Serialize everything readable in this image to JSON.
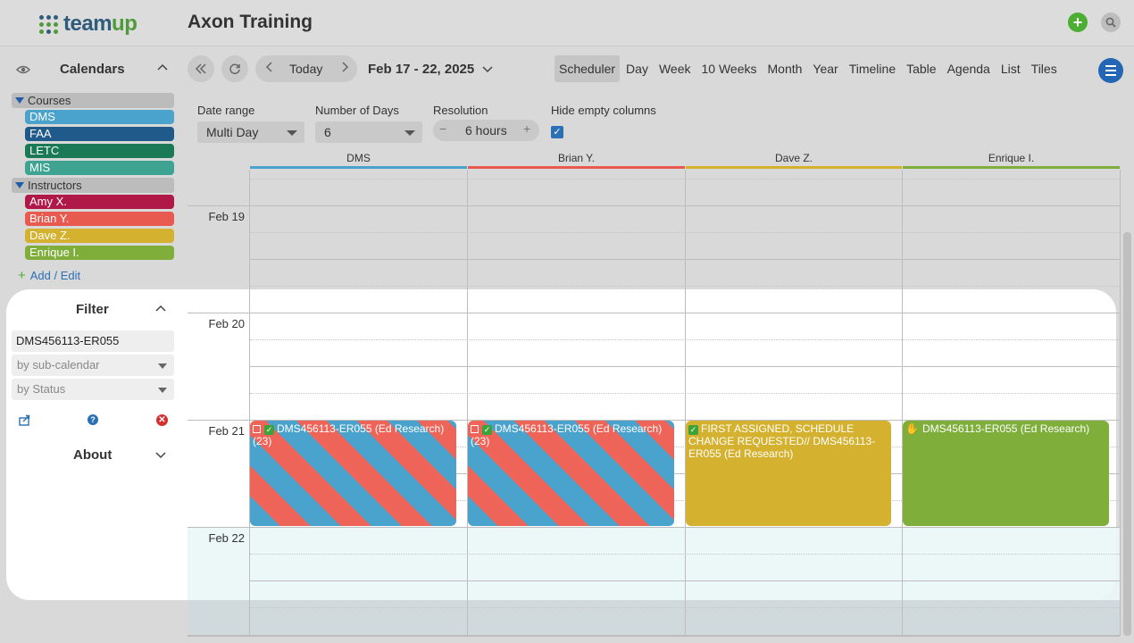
{
  "header": {
    "logo_text_1": "team",
    "logo_text_2": "up",
    "app_title": "Axon Training",
    "add_icon": "plus-icon",
    "search_icon": "search-icon"
  },
  "sidebar": {
    "calendars_title": "Calendars",
    "groups": [
      {
        "label": "Courses"
      },
      {
        "label": "Instructors"
      }
    ],
    "courses": [
      {
        "label": "DMS",
        "color": "#4aa3cc"
      },
      {
        "label": "FAA",
        "color": "#1f5a8a"
      },
      {
        "label": "LETC",
        "color": "#1a7a55"
      },
      {
        "label": "MIS",
        "color": "#3fa392"
      }
    ],
    "instructors": [
      {
        "label": "Amy X.",
        "color": "#b01848"
      },
      {
        "label": "Brian Y.",
        "color": "#e85a4f"
      },
      {
        "label": "Dave Z.",
        "color": "#d4b12e"
      },
      {
        "label": "Enrique I.",
        "color": "#7fae3a"
      }
    ],
    "add_edit": "Add / Edit"
  },
  "filter": {
    "title": "Filter",
    "search_value": "DMS456113-ER055",
    "sub_calendar_placeholder": "by sub-calendar",
    "status_placeholder": "by Status",
    "about_title": "About"
  },
  "toolbar": {
    "today": "Today",
    "date_range": "Feb 17 - 22, 2025",
    "views": [
      "Scheduler",
      "Day",
      "Week",
      "10 Weeks",
      "Month",
      "Year",
      "Timeline",
      "Table",
      "Agenda",
      "List",
      "Tiles"
    ],
    "active_view": "Scheduler"
  },
  "options": {
    "date_range_label": "Date range",
    "date_range_value": "Multi Day",
    "num_days_label": "Number of Days",
    "num_days_value": "6",
    "resolution_label": "Resolution",
    "resolution_value": "6 hours",
    "hide_empty_label": "Hide empty columns",
    "hide_empty_checked": true
  },
  "scheduler": {
    "columns": [
      "DMS",
      "Brian Y.",
      "Dave Z.",
      "Enrique I."
    ],
    "column_colors": [
      "#4aa3cc",
      "#e85a4f",
      "#d4b12e",
      "#7fae3a"
    ],
    "days": [
      "Feb 19",
      "Feb 20",
      "Feb 21",
      "Feb 22"
    ],
    "events": [
      {
        "title": "DMS456113-ER055 (Ed Research) (23)"
      },
      {
        "title": "DMS456113-ER055 (Ed Research) (23)"
      },
      {
        "title": "FIRST ASSIGNED, SCHEDULE CHANGE REQUESTED// DMS456113-ER055 (Ed Research)"
      },
      {
        "title": "DMS456113-ER055 (Ed Research)"
      }
    ]
  }
}
